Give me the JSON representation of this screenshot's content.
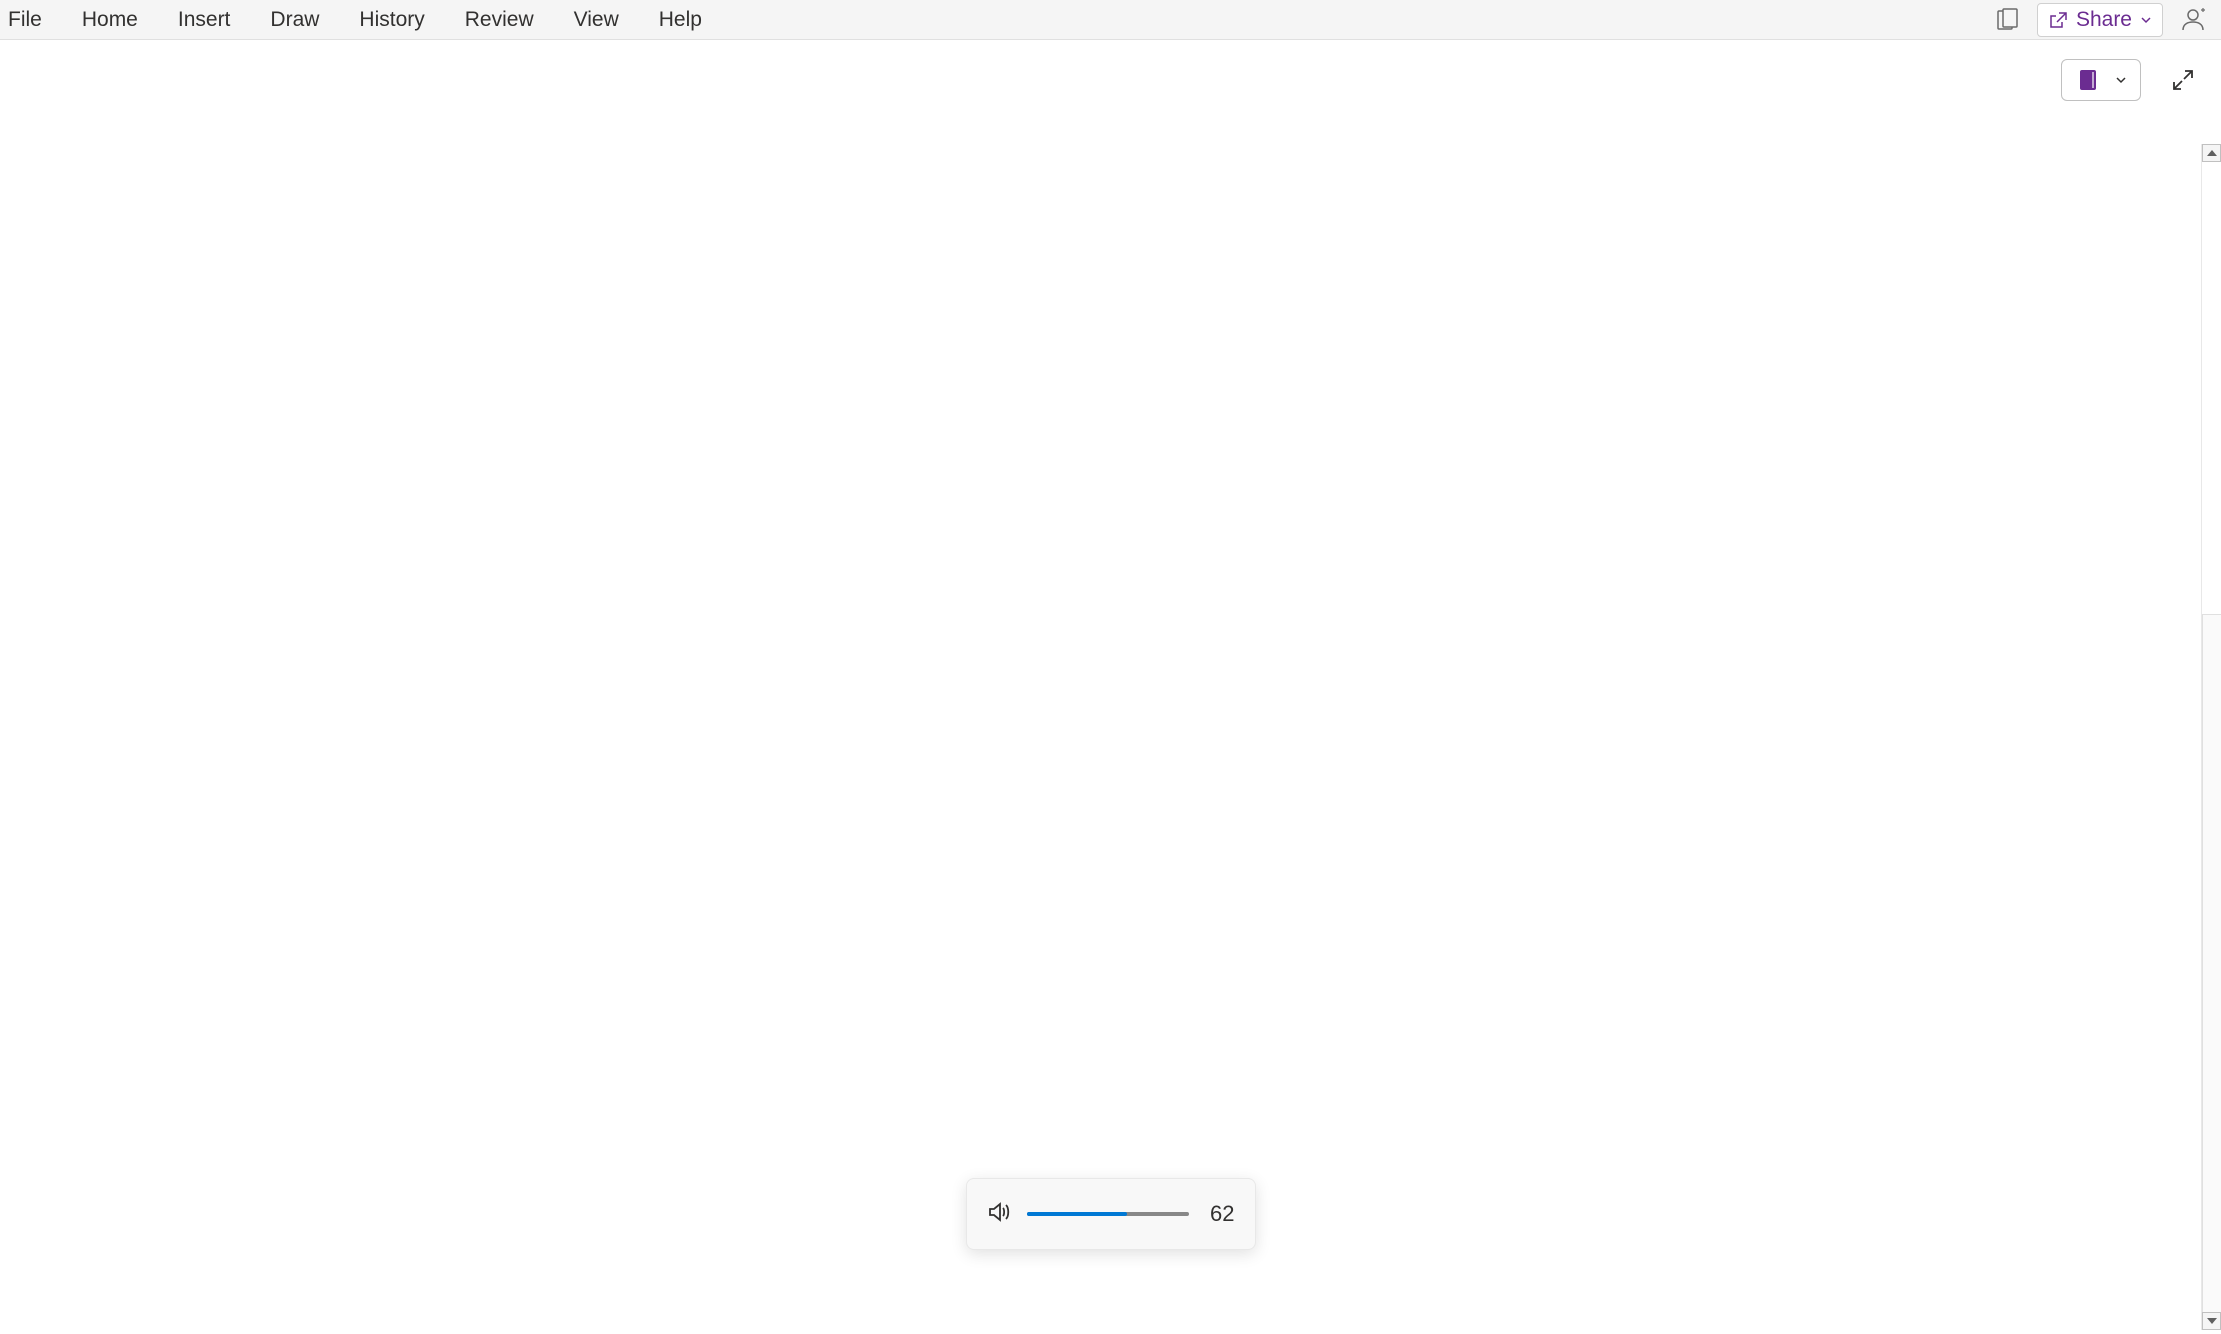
{
  "menu": {
    "items": [
      {
        "label": "File"
      },
      {
        "label": "Home"
      },
      {
        "label": "Insert"
      },
      {
        "label": "Draw"
      },
      {
        "label": "History"
      },
      {
        "label": "Review"
      },
      {
        "label": "View"
      },
      {
        "label": "Help"
      }
    ]
  },
  "share": {
    "label": "Share"
  },
  "volume": {
    "value": "62",
    "percent": 62
  }
}
